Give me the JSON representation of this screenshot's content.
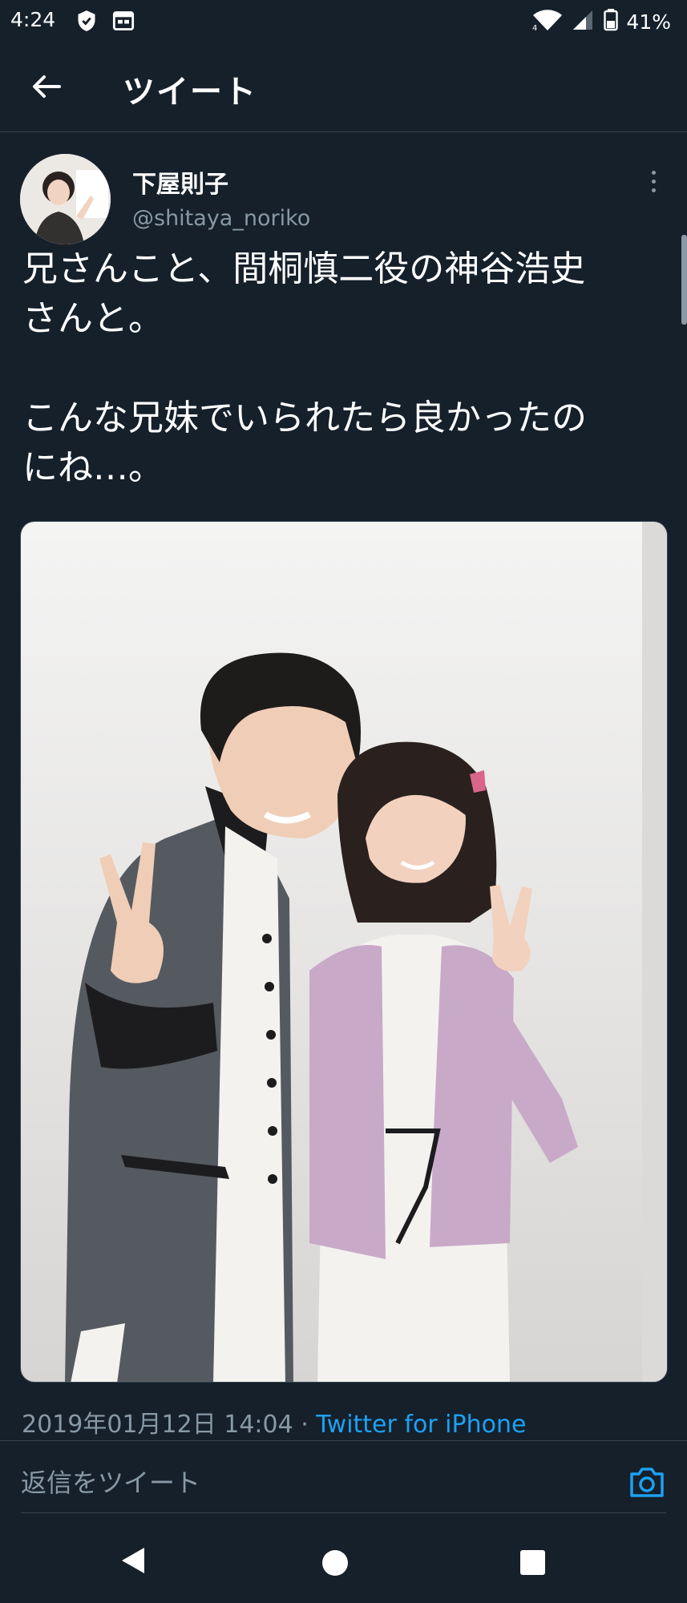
{
  "status_bar": {
    "time": "4:24",
    "battery": "41%",
    "icons": [
      "shield-icon",
      "calendar-icon",
      "wifi-icon",
      "signal-icon",
      "battery-icon"
    ]
  },
  "header": {
    "title": "ツイート",
    "back_icon": "arrow-left-icon"
  },
  "tweet": {
    "author_name": "下屋則子",
    "author_handle": "@shitaya_noriko",
    "text": "兄さんこと、間桐慎二役の神谷浩史\nさんと。\n\nこんな兄妹でいられたら良かったの\nにね…。",
    "timestamp": "2019年01月12日 14:04 · ",
    "source": "Twitter for iPhone",
    "more_icon": "more-vertical-icon"
  },
  "reply_bar": {
    "placeholder": "返信をツイート",
    "camera_icon": "camera-icon"
  },
  "nav_bar": {
    "icons": [
      "back-triangle-icon",
      "home-circle-icon",
      "recent-square-icon"
    ]
  },
  "colors": {
    "background": "#15202b",
    "divider": "#38444d",
    "secondary_text": "#8899a6",
    "accent": "#1da1f2"
  }
}
